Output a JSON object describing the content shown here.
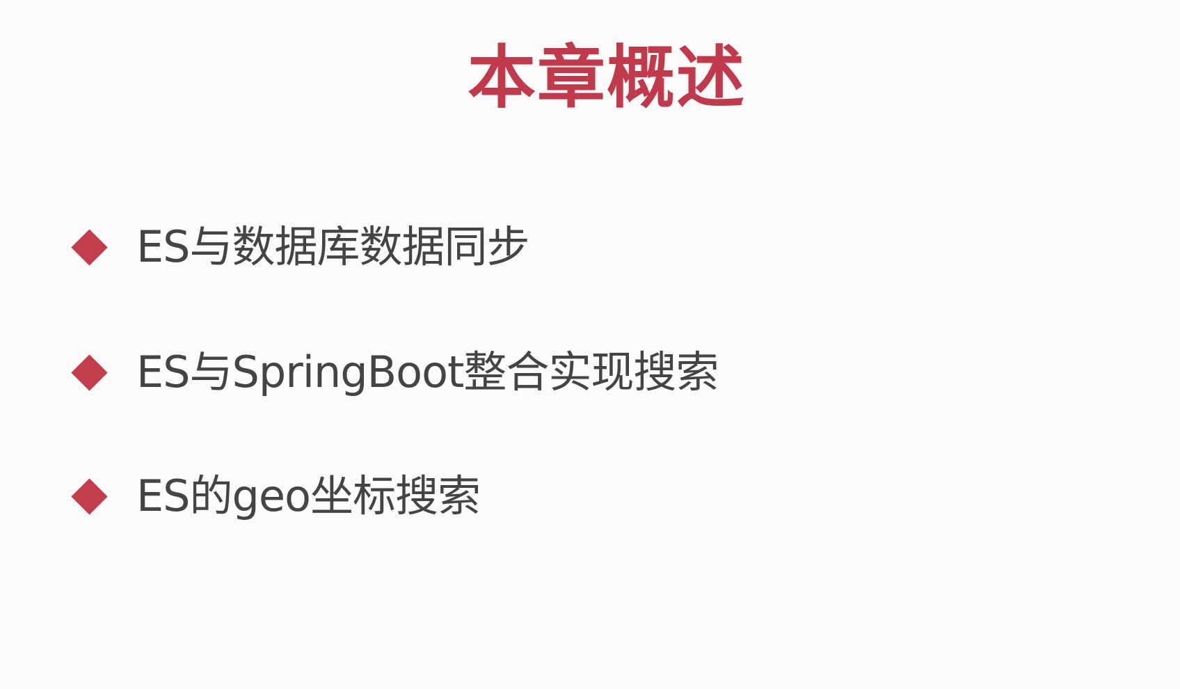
{
  "slide": {
    "title": "本章概述",
    "bullets": [
      {
        "icon": "diamond-bullet-icon",
        "text": "ES与数据库数据同步"
      },
      {
        "icon": "diamond-bullet-icon",
        "text": "ES与SpringBoot整合实现搜索"
      },
      {
        "icon": "diamond-bullet-icon",
        "text": "ES的geo坐标搜索"
      }
    ]
  },
  "colors": {
    "background": "#fcfbfb",
    "title": "#c03a4b",
    "accent": "#c43d4d",
    "text": "#444444"
  }
}
